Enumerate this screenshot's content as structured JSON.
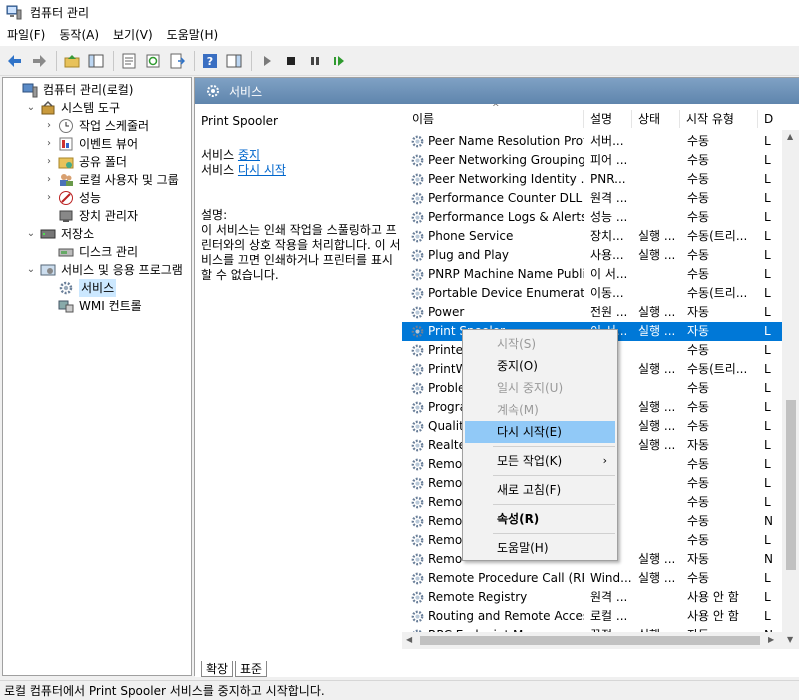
{
  "window": {
    "title": "컴퓨터 관리"
  },
  "menu": [
    "파일(F)",
    "동작(A)",
    "보기(V)",
    "도움말(H)"
  ],
  "tree": [
    {
      "label": "컴퓨터 관리(로컬)",
      "icon": "computer-icon",
      "indent": 0,
      "chevron": ""
    },
    {
      "label": "시스템 도구",
      "icon": "tools-icon",
      "indent": 1,
      "chevron": "v"
    },
    {
      "label": "작업 스케줄러",
      "icon": "clock-icon",
      "indent": 2,
      "chevron": ">"
    },
    {
      "label": "이벤트 뷰어",
      "icon": "event-viewer-icon",
      "indent": 2,
      "chevron": ">"
    },
    {
      "label": "공유 폴더",
      "icon": "shared-folder-icon",
      "indent": 2,
      "chevron": ">"
    },
    {
      "label": "로컬 사용자 및 그룹",
      "icon": "users-icon",
      "indent": 2,
      "chevron": ">"
    },
    {
      "label": "성능",
      "icon": "performance-icon",
      "indent": 2,
      "chevron": ">"
    },
    {
      "label": "장치 관리자",
      "icon": "device-manager-icon",
      "indent": 2,
      "chevron": ""
    },
    {
      "label": "저장소",
      "icon": "storage-icon",
      "indent": 1,
      "chevron": "v"
    },
    {
      "label": "디스크 관리",
      "icon": "disk-icon",
      "indent": 2,
      "chevron": ""
    },
    {
      "label": "서비스 및 응용 프로그램",
      "icon": "services-apps-icon",
      "indent": 1,
      "chevron": "v"
    },
    {
      "label": "서비스",
      "icon": "gear-icon",
      "indent": 2,
      "chevron": "",
      "selected": true
    },
    {
      "label": "WMI 컨트롤",
      "icon": "wmi-icon",
      "indent": 2,
      "chevron": ""
    }
  ],
  "header": {
    "title": "서비스"
  },
  "description": {
    "service_name": "Print Spooler",
    "stop_prefix": "서비스 ",
    "stop_link": "중지",
    "restart_prefix": "서비스 ",
    "restart_link": "다시 시작",
    "desc_label": "설명:",
    "desc_text": "이 서비스는 인쇄 작업을 스풀링하고 프린터와의 상호 작용을 처리합니다. 이 서비스를 끄면 인쇄하거나 프린터를 표시할 수 없습니다."
  },
  "columns": [
    "이름",
    "설명",
    "상태",
    "시작 유형",
    "D"
  ],
  "rows": [
    {
      "name": "Peer Name Resolution Prot...",
      "desc": "서버...",
      "status": "",
      "startup": "수동",
      "logon": "L"
    },
    {
      "name": "Peer Networking Grouping",
      "desc": "피어 ...",
      "status": "",
      "startup": "수동",
      "logon": "L"
    },
    {
      "name": "Peer Networking Identity ...",
      "desc": "PNR...",
      "status": "",
      "startup": "수동",
      "logon": "L"
    },
    {
      "name": "Performance Counter DLL ...",
      "desc": "원격 ...",
      "status": "",
      "startup": "수동",
      "logon": "L"
    },
    {
      "name": "Performance Logs & Alerts",
      "desc": "성능 ...",
      "status": "",
      "startup": "수동",
      "logon": "L"
    },
    {
      "name": "Phone Service",
      "desc": "장치...",
      "status": "실행 ...",
      "startup": "수동(트리...",
      "logon": "L"
    },
    {
      "name": "Plug and Play",
      "desc": "사용...",
      "status": "실행 ...",
      "startup": "수동",
      "logon": "L"
    },
    {
      "name": "PNRP Machine Name Publi...",
      "desc": "이 서...",
      "status": "",
      "startup": "수동",
      "logon": "L"
    },
    {
      "name": "Portable Device Enumerato...",
      "desc": "이동...",
      "status": "",
      "startup": "수동(트리...",
      "logon": "L"
    },
    {
      "name": "Power",
      "desc": "전원 ...",
      "status": "실행 ...",
      "startup": "자동",
      "logon": "L"
    },
    {
      "name": "Print Spooler",
      "desc": "이 서...",
      "status": "실행 ...",
      "startup": "자동",
      "logon": "L",
      "selected": true
    },
    {
      "name": "Printe",
      "desc": "",
      "status": "",
      "startup": "수동",
      "logon": "L"
    },
    {
      "name": "PrintW",
      "desc": "",
      "status": "실행 ...",
      "startup": "수동(트리...",
      "logon": "L"
    },
    {
      "name": "Proble",
      "desc": "",
      "status": "",
      "startup": "수동",
      "logon": "L"
    },
    {
      "name": "Progra",
      "desc": "",
      "status": "실행 ...",
      "startup": "수동",
      "logon": "L"
    },
    {
      "name": "Qualit",
      "desc": "",
      "status": "실행 ...",
      "startup": "수동",
      "logon": "L"
    },
    {
      "name": "Realte",
      "desc": "",
      "status": "실행 ...",
      "startup": "자동",
      "logon": "L"
    },
    {
      "name": "Remo",
      "desc": "",
      "status": "",
      "startup": "수동",
      "logon": "L"
    },
    {
      "name": "Remo",
      "desc": "",
      "status": "",
      "startup": "수동",
      "logon": "L"
    },
    {
      "name": "Remo",
      "desc": "",
      "status": "",
      "startup": "수동",
      "logon": "L"
    },
    {
      "name": "Remo",
      "desc": "",
      "status": "",
      "startup": "수동",
      "logon": "N"
    },
    {
      "name": "Remo",
      "desc": "",
      "status": "",
      "startup": "수동",
      "logon": "L"
    },
    {
      "name": "Remo",
      "desc": "",
      "status": "실행 ...",
      "startup": "자동",
      "logon": "N"
    },
    {
      "name": "Remote Procedure Call (RP...",
      "desc": "Wind...",
      "status": "실행 ...",
      "startup": "수동",
      "logon": "L"
    },
    {
      "name": "Remote Registry",
      "desc": "원격 ...",
      "status": "",
      "startup": "사용 안 함",
      "logon": "L"
    },
    {
      "name": "Routing and Remote Access",
      "desc": "로컬 ...",
      "status": "",
      "startup": "사용 안 함",
      "logon": "L"
    },
    {
      "name": "RPC Endpoint Mapper",
      "desc": "끝점...",
      "status": "실행 ...",
      "startup": "자동",
      "logon": "N"
    }
  ],
  "context_menu": [
    {
      "label": "시작(S)",
      "disabled": true
    },
    {
      "label": "중지(O)",
      "disabled": false
    },
    {
      "label": "일시 중지(U)",
      "disabled": true
    },
    {
      "label": "계속(M)",
      "disabled": true
    },
    {
      "label": "다시 시작(E)",
      "disabled": false,
      "hover": true
    },
    {
      "separator": true
    },
    {
      "label": "모든 작업(K)",
      "disabled": false,
      "submenu": true
    },
    {
      "separator": true
    },
    {
      "label": "새로 고침(F)",
      "disabled": false
    },
    {
      "separator": true
    },
    {
      "label": "속성(R)",
      "disabled": false,
      "bold": true
    },
    {
      "separator": true
    },
    {
      "label": "도움말(H)",
      "disabled": false
    }
  ],
  "tabs": [
    "확장",
    "표준"
  ],
  "status": "로컬 컴퓨터에서 Print Spooler 서비스를 중지하고 시작합니다.",
  "colors": {
    "selection": "#0078d7",
    "hover": "#91c9f7",
    "header": "#6a8fb5",
    "link": "#0066cc"
  }
}
